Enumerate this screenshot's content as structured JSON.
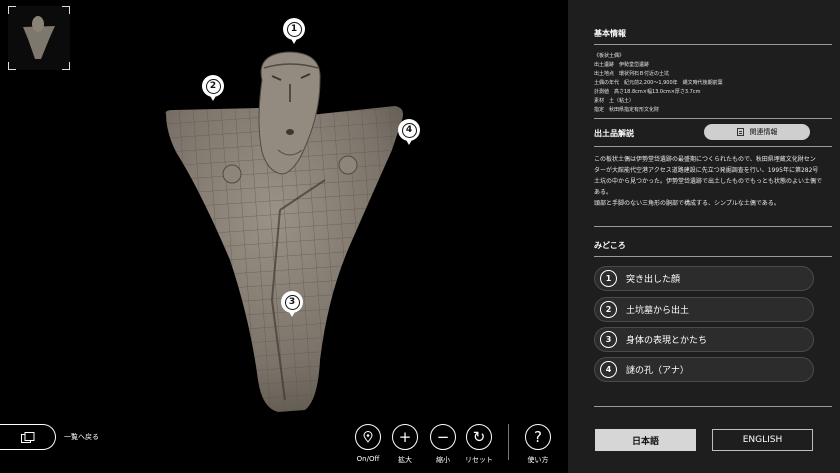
{
  "viewer": {
    "pins": [
      {
        "number": "1"
      },
      {
        "number": "2"
      },
      {
        "number": "3"
      },
      {
        "number": "4"
      }
    ],
    "back_label": "一覧へ戻る",
    "controls": [
      {
        "icon": "pin-icon",
        "label": "On/Off"
      },
      {
        "icon": "plus-icon",
        "label": "拡大",
        "glyph": "+"
      },
      {
        "icon": "minus-icon",
        "label": "縮小",
        "glyph": "−"
      },
      {
        "icon": "reset-icon",
        "label": "リセット",
        "glyph": "↻"
      },
      {
        "icon": "help-icon",
        "label": "使い方",
        "glyph": "?"
      }
    ]
  },
  "panel": {
    "basic_title": "基本情報",
    "basic_lines": [
      "《板状土偶》",
      "出土遺跡　伊勢堂岱遺跡",
      "出土地点　環状列石Ｂ付近の土坑",
      "土偶の年代　紀元前2,200〜1,900年　縄文時代後期前葉",
      "計測値　高さ18.8cm×幅13.0cm×厚さ3.7cm",
      "素材　土（粘土）",
      "指定　秋田県指定有形文化財"
    ],
    "commentary_title": "出土品解説",
    "related_label": "関連情報",
    "description": [
      "この板状土偶は伊勢堂岱遺跡の最盛期につくられたもので、秋田県埋蔵文化財セン",
      "ターが大館能代空港アクセス道路建設に先立つ発掘調査を行い、1995年に第282号",
      "土坑の中から見つかった。伊勢堂岱遺跡で出土したものでもっとも状態のよい土偶で",
      "ある。",
      "頭部と手脚のない三角形の胴部で構成する、シンプルな土偶である。"
    ],
    "highlights_title": "みどころ",
    "highlights": [
      {
        "number": "1",
        "label": "突き出した顔"
      },
      {
        "number": "2",
        "label": "土坑墓から出土"
      },
      {
        "number": "3",
        "label": "身体の表現とかたち"
      },
      {
        "number": "4",
        "label": "謎の孔（アナ）"
      }
    ],
    "languages": {
      "ja": "日本語",
      "en": "ENGLISH"
    }
  },
  "colors": {
    "panel_bg": "#1e1e1e",
    "viewer_bg": "#000000",
    "clay": "#8a8276"
  }
}
